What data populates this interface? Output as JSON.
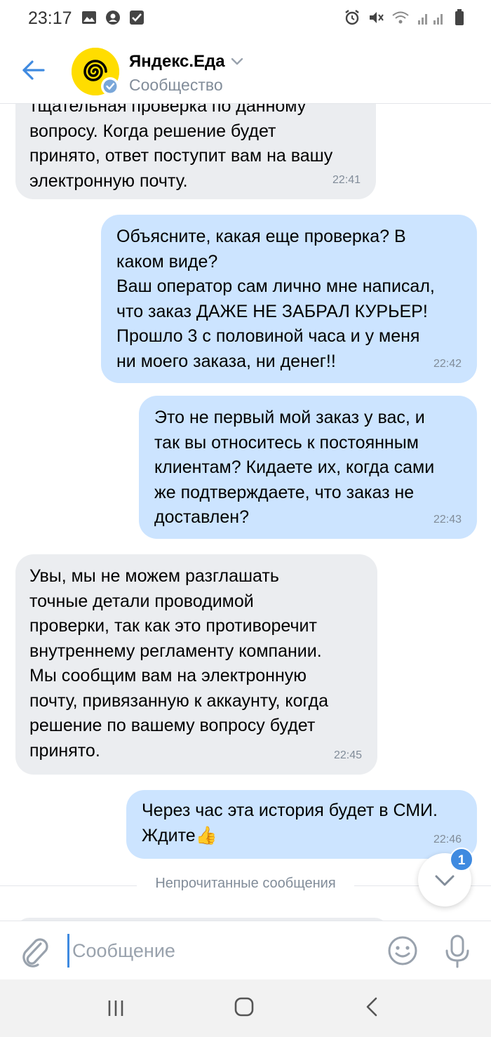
{
  "status_bar": {
    "time": "23:17",
    "left_icons": [
      "gallery-icon",
      "messenger-icon",
      "checkbox-icon"
    ],
    "right_icons": [
      "alarm-icon",
      "mute-icon",
      "wifi-icon",
      "signal-icon",
      "battery-icon"
    ]
  },
  "header": {
    "title": "Яндекс.Еда",
    "subtitle": "Сообщество",
    "accent": "#3f8ae0",
    "avatar_color": "#ffdd00"
  },
  "messages": [
    {
      "direction": "incoming",
      "text": "тщательная проверка по данному\nвопросу. Когда решение будет\nпринято, ответ поступит вам на вашу\nэлектронную почту.",
      "time": "22:41"
    },
    {
      "direction": "outgoing",
      "text": "Объясните, какая еще проверка? В\nкаком виде?\nВаш оператор сам лично мне написал,\nчто заказ ДАЖЕ НЕ ЗАБРАЛ КУРЬЕР!\nПрошло 3 с половиной часа и у меня\nни моего заказа, ни денег!!",
      "time": "22:42"
    },
    {
      "direction": "outgoing",
      "text": "Это не первый мой заказ у вас, и\nтак вы относитесь к постоянным\nклиентам? Кидаете их, когда сами\nже подтверждаете, что заказ не\nдоставлен?",
      "time": "22:43"
    },
    {
      "direction": "incoming",
      "text": "Увы, мы не можем разглашать\nточные детали проводимой\nпроверки, так как это противоречит\nвнутреннему регламенту компании.\nМы сообщим вам на электронную\nпочту, привязанную к аккаунту, когда\nрешение по вашему вопросу будет\nпринято.",
      "time": "22:45"
    },
    {
      "direction": "outgoing",
      "text": "Через час эта история будет в СМИ.\nЖдите👍",
      "time": "22:46"
    }
  ],
  "unread_divider": "Непрочитанные сообщения",
  "unread_count": "1",
  "composer": {
    "placeholder": "Сообщение"
  },
  "colors": {
    "incoming_bubble": "#ebedf0",
    "outgoing_bubble": "#cce4ff",
    "secondary_text": "#818c99"
  }
}
